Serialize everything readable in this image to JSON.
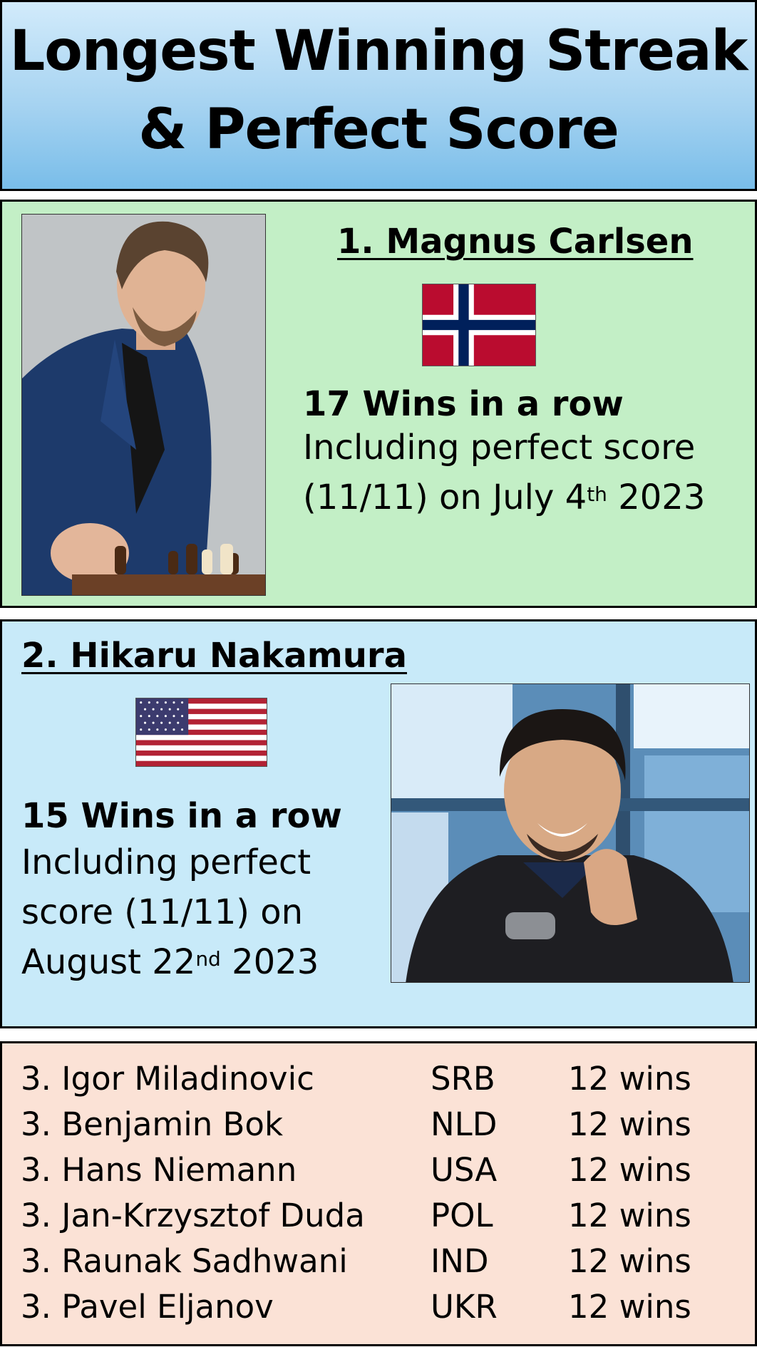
{
  "header": {
    "title_line1": "Longest Winning Streak",
    "title_line2": "& Perfect Score"
  },
  "first": {
    "name": "1. Magnus Carlsen",
    "flag": "norway-flag",
    "streak": "17 Wins in a row",
    "detail_line1": "Including perfect score",
    "detail_line2_pre": "(11/11) on July 4",
    "detail_line2_sup": "th",
    "detail_line2_post": " 2023"
  },
  "second": {
    "name": "2. Hikaru Nakamura",
    "flag": "usa-flag",
    "streak": "15 Wins in a row",
    "detail_line1": "Including perfect",
    "detail_line2": "score (11/11) on",
    "detail_line3_pre": "August 22",
    "detail_line3_sup": "nd",
    "detail_line3_post": " 2023"
  },
  "others": [
    {
      "rank_name": "3. Igor Miladinovic",
      "country": "SRB",
      "wins": "12 wins"
    },
    {
      "rank_name": "3. Benjamin Bok",
      "country": "NLD",
      "wins": "12 wins"
    },
    {
      "rank_name": "3. Hans Niemann",
      "country": "USA",
      "wins": "12 wins"
    },
    {
      "rank_name": "3. Jan-Krzysztof Duda",
      "country": "POL",
      "wins": "12 wins"
    },
    {
      "rank_name": "3. Raunak Sadhwani",
      "country": "IND",
      "wins": "12 wins"
    },
    {
      "rank_name": "3. Pavel Eljanov",
      "country": "UKR",
      "wins": "12 wins"
    }
  ],
  "colors": {
    "header_gradient_top": "#d2ebfb",
    "header_gradient_bottom": "#79bde9",
    "panel_green": "#c3efc6",
    "panel_blue": "#c8eaf9",
    "panel_peach": "#fbe2d6",
    "norway_red": "#ba0c2f",
    "norway_blue": "#00205b",
    "usa_red": "#b22234",
    "usa_blue": "#3c3b6e"
  }
}
